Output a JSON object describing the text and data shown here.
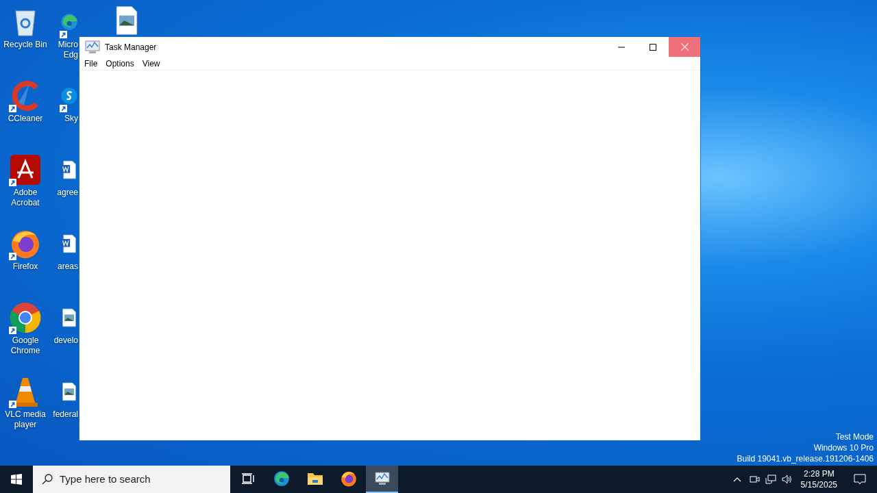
{
  "desktop": {
    "icons": [
      {
        "kind": "recycle",
        "shortcut": false,
        "label_lines": [
          "Recycle Bin"
        ]
      },
      {
        "kind": "ccleaner",
        "shortcut": true,
        "label_lines": [
          "CCleaner"
        ]
      },
      {
        "kind": "acrobat",
        "shortcut": true,
        "label_lines": [
          "Adobe",
          "Acrobat"
        ]
      },
      {
        "kind": "firefox",
        "shortcut": true,
        "label_lines": [
          "Firefox"
        ]
      },
      {
        "kind": "chrome",
        "shortcut": true,
        "label_lines": [
          "Google",
          "Chrome"
        ]
      },
      {
        "kind": "vlc",
        "shortcut": true,
        "label_lines": [
          "VLC media",
          "player"
        ]
      },
      {
        "kind": "edge",
        "shortcut": true,
        "label_lines": [
          "Micro",
          "Edg"
        ]
      },
      {
        "kind": "skype",
        "shortcut": true,
        "label_lines": [
          "Sky"
        ]
      },
      {
        "kind": "word",
        "shortcut": false,
        "label_lines": [
          "agree"
        ]
      },
      {
        "kind": "word",
        "shortcut": false,
        "label_lines": [
          "areas"
        ]
      },
      {
        "kind": "image",
        "shortcut": false,
        "label_lines": [
          "develo"
        ]
      },
      {
        "kind": "image",
        "shortcut": false,
        "label_lines": [
          "federal"
        ]
      },
      {
        "kind": "image",
        "shortcut": false
      }
    ],
    "system_info": [
      "Test Mode",
      "Windows 10 Pro",
      "Build 19041.vb_release.191206-1406"
    ]
  },
  "window": {
    "title": "Task Manager",
    "menu": [
      "File",
      "Options",
      "View"
    ]
  },
  "taskbar": {
    "search": {
      "placeholder": "Type here to search"
    },
    "apps": [
      {
        "kind": "taskview",
        "selected": false
      },
      {
        "kind": "edge",
        "selected": false
      },
      {
        "kind": "explorer",
        "selected": false
      },
      {
        "kind": "firefox",
        "selected": false
      },
      {
        "kind": "taskmanager",
        "selected": true
      }
    ],
    "clock": {
      "time": "2:28 PM",
      "date": "5/15/2025"
    }
  }
}
